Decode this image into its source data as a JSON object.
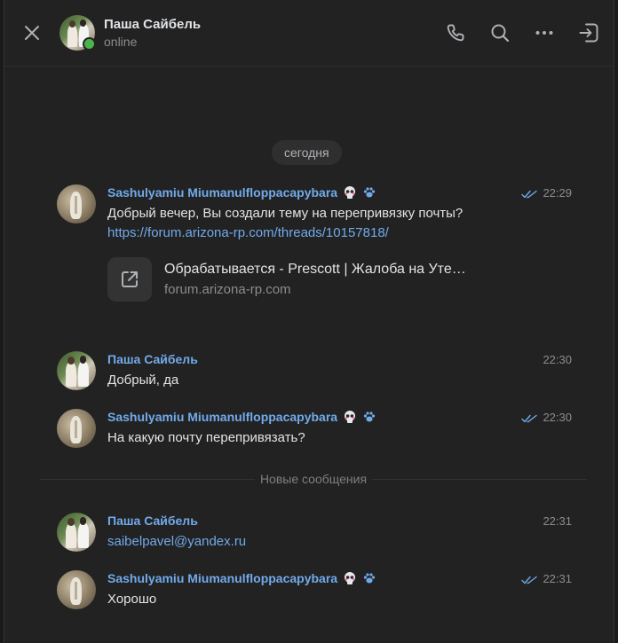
{
  "header": {
    "name": "Паша Сайбель",
    "status": "online"
  },
  "date_label": "сегодня",
  "new_messages_label": "Новые сообщения",
  "messages": [
    {
      "author": "Sashulyamiu Miumanulfloppacapybara",
      "time": "22:29",
      "text": "Добрый вечер, Вы создали тему на перепривязку почты?",
      "link": "https://forum.arizona-rp.com/threads/10157818/",
      "preview_title": "Обрабатывается - Prescott | Жалоба на Уте…",
      "preview_domain": "forum.arizona-rp.com",
      "read": true
    },
    {
      "author": "Паша Сайбель",
      "time": "22:30",
      "text": "Добрый, да"
    },
    {
      "author": "Sashulyamiu Miumanulfloppacapybara",
      "time": "22:30",
      "text": "На какую почту перепривязать?",
      "read": true
    },
    {
      "author": "Паша Сайбель",
      "time": "22:31",
      "link": "saibelpavel@yandex.ru"
    },
    {
      "author": "Sashulyamiu Miumanulfloppacapybara",
      "time": "22:31",
      "text": "Хорошо",
      "read": true
    }
  ],
  "colors": {
    "background": "#222222",
    "accent": "#71aaeb",
    "text": "#e1e3e6",
    "muted": "#8a8c90",
    "online": "#4bb34b"
  },
  "icons": [
    "close-icon",
    "phone-icon",
    "search-icon",
    "more-icon",
    "exit-icon",
    "external-link-icon",
    "double-check-icon",
    "skull-emoji-icon",
    "paw-emoji-icon"
  ]
}
